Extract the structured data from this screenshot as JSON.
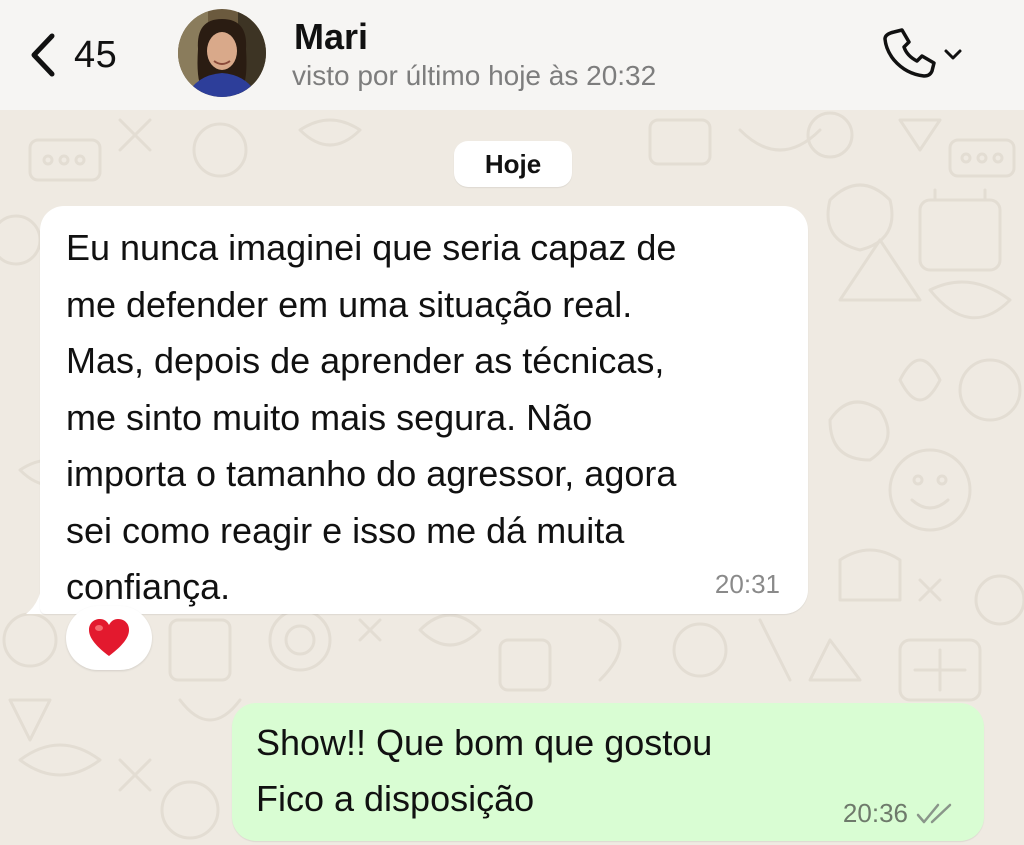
{
  "header": {
    "back_count": "45",
    "contact_name": "Mari",
    "last_seen": "visto por último hoje às 20:32"
  },
  "date_chip": "Hoje",
  "messages": [
    {
      "direction": "incoming",
      "text": "Eu nunca imaginei que seria capaz de\nme defender em uma situação real.\nMas, depois de aprender as técnicas,\nme sinto muito mais segura. Não\nimporta o tamanho do agressor, agora\nsei como reagir e isso me dá muita\nconfiança.",
      "time": "20:31",
      "reaction": "❤️"
    },
    {
      "direction": "outgoing",
      "text": "Show!! Que bom que gostou\nFico a disposição",
      "time": "20:36",
      "status": "read"
    }
  ],
  "colors": {
    "wallpaper": "#efeae2",
    "header": "#f6f5f3",
    "incoming_bubble": "#ffffff",
    "outgoing_bubble": "#d9fdd3",
    "read_ticks": "#8a968a"
  },
  "icons": {
    "back": "chevron-left-icon",
    "call": "phone-icon",
    "call_menu": "chevron-down-icon",
    "status": "double-check-icon",
    "reaction": "heart-icon"
  }
}
